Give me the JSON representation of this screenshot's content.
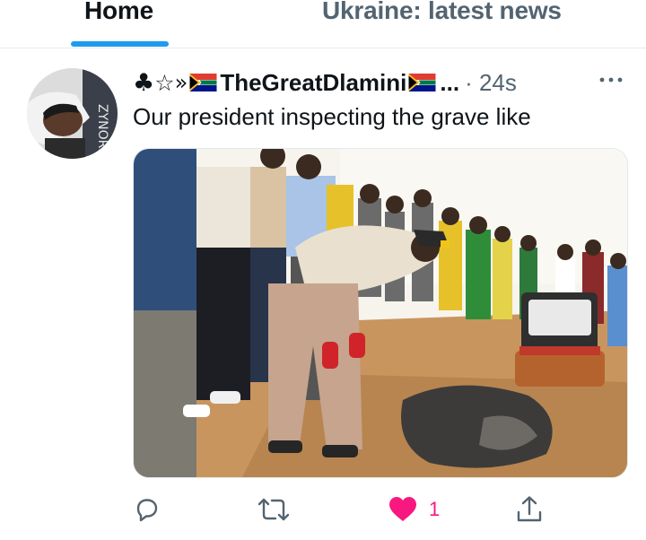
{
  "tabs": [
    {
      "label": "Home",
      "active": true
    },
    {
      "label": "Ukraine: latest news",
      "active": false
    }
  ],
  "tweet": {
    "deco_club": "♣",
    "deco_star": "☆",
    "deco_guillemet": "»",
    "display_name": "TheGreatDlamini",
    "ellipsis": "...",
    "timestamp": "· 24s",
    "text": "Our president inspecting the grave like",
    "likes": "1"
  },
  "icons": {
    "reply": "reply-icon",
    "retweet": "retweet-icon",
    "like": "heart-icon",
    "share": "share-icon",
    "more": "more-icon",
    "flag": "south-africa-flag-icon"
  },
  "colors": {
    "accent": "#1d9bf0",
    "like": "#f91880",
    "muted": "#536471",
    "text": "#0f1419"
  }
}
